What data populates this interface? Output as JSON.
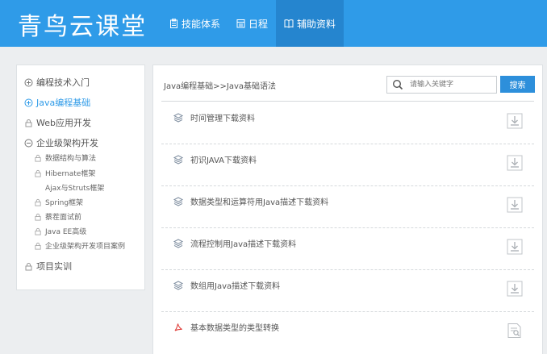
{
  "header": {
    "logo_text": "青鸟云课堂",
    "nav": [
      {
        "label": "技能体系",
        "icon": "clipboard-icon"
      },
      {
        "label": "日程",
        "icon": "calendar-icon"
      },
      {
        "label": "辅助资料",
        "icon": "book-icon",
        "active": true
      }
    ]
  },
  "sidebar": {
    "items": [
      {
        "label": "编程技术入门",
        "icon": "plus-circle-icon"
      },
      {
        "label": "Java编程基础",
        "icon": "plus-circle-icon",
        "active": true
      },
      {
        "label": "Web应用开发",
        "icon": "lock-icon"
      },
      {
        "label": "企业级架构开发",
        "icon": "minus-circle-icon"
      },
      {
        "label": "项目实训",
        "icon": "lock-icon"
      }
    ],
    "subitems": [
      {
        "label": "数据结构与算法",
        "icon": "lock-icon"
      },
      {
        "label": "Hibernate框架",
        "icon": "lock-icon"
      },
      {
        "label": "Ajax与Struts框架",
        "icon": "none"
      },
      {
        "label": "Spring框架",
        "icon": "lock-icon"
      },
      {
        "label": "蔡茬面试前",
        "icon": "lock-icon"
      },
      {
        "label": "Java EE高级",
        "icon": "lock-icon"
      },
      {
        "label": "企业级架构开发项目案例",
        "icon": "lock-icon"
      }
    ]
  },
  "main": {
    "breadcrumb": "Java编程基础>>Java基础语法",
    "search": {
      "placeholder": "请输入关键字",
      "button_label": "搜索"
    },
    "resources": [
      {
        "title": "时间管理下载资料",
        "type": "layers-icon",
        "action": "download-icon"
      },
      {
        "title": "初识JAVA下载资料",
        "type": "layers-icon",
        "action": "download-icon"
      },
      {
        "title": "数据类型和运算符用Java描述下载资料",
        "type": "layers-icon",
        "action": "download-icon"
      },
      {
        "title": "流程控制用Java描述下载资料",
        "type": "layers-icon",
        "action": "download-icon"
      },
      {
        "title": "数组用Java描述下载资料",
        "type": "layers-icon",
        "action": "download-icon"
      },
      {
        "title": "基本数据类型的类型转换",
        "type": "pdf-icon",
        "action": "preview-icon"
      }
    ]
  },
  "colors": {
    "brand": "#2f9be8",
    "nav_active": "#2585cf",
    "button": "#2d8fdb",
    "pdf": "#e0403c"
  }
}
